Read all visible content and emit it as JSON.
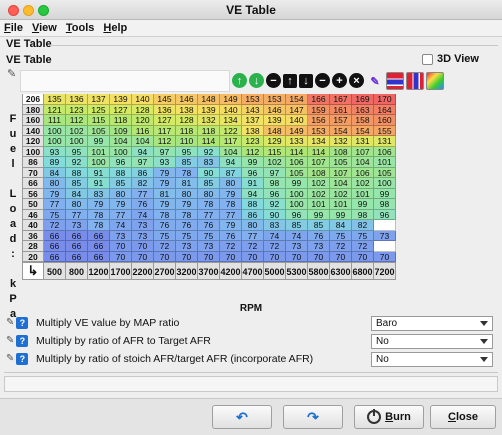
{
  "window": {
    "title": "VE Table"
  },
  "menu": [
    "File",
    "View",
    "Tools",
    "Help"
  ],
  "panel_title": "VE Table",
  "table_title": "VE Table",
  "view3d_label": "3D View",
  "y_axis_label": [
    "F",
    "u",
    "e",
    "l",
    "",
    "L",
    "o",
    "a",
    "d",
    ":",
    "",
    "k",
    "P",
    "a"
  ],
  "y_bins": [
    206,
    180,
    160,
    140,
    120,
    100,
    86,
    70,
    66,
    56,
    50,
    46,
    40,
    36,
    28,
    20
  ],
  "x_bins": [
    500,
    800,
    1200,
    1700,
    2200,
    2700,
    3200,
    3700,
    4200,
    4700,
    5000,
    5300,
    5800,
    6300,
    6800,
    7200
  ],
  "x_axis_label": "RPM",
  "table": [
    [
      135,
      136,
      137,
      139,
      140,
      145,
      146,
      148,
      149,
      153,
      153,
      154,
      166,
      167,
      169,
      170
    ],
    [
      121,
      123,
      125,
      127,
      128,
      136,
      138,
      139,
      140,
      143,
      146,
      147,
      159,
      161,
      163,
      164
    ],
    [
      111,
      112,
      115,
      118,
      120,
      127,
      128,
      132,
      134,
      137,
      139,
      140,
      156,
      157,
      158,
      160
    ],
    [
      100,
      102,
      105,
      109,
      116,
      117,
      118,
      118,
      122,
      138,
      148,
      149,
      153,
      154,
      154,
      155
    ],
    [
      100,
      100,
      99,
      104,
      104,
      112,
      110,
      114,
      117,
      123,
      129,
      133,
      134,
      132,
      131,
      131
    ],
    [
      93,
      95,
      101,
      100,
      94,
      97,
      95,
      92,
      104,
      112,
      115,
      114,
      114,
      108,
      107,
      106
    ],
    [
      89,
      92,
      100,
      96,
      97,
      93,
      85,
      83,
      94,
      99,
      102,
      106,
      107,
      105,
      104,
      101
    ],
    [
      84,
      88,
      91,
      88,
      86,
      79,
      78,
      90,
      87,
      96,
      97,
      105,
      108,
      107,
      106,
      105
    ],
    [
      80,
      85,
      91,
      85,
      82,
      79,
      81,
      85,
      80,
      91,
      98,
      99,
      102,
      104,
      102,
      100
    ],
    [
      79,
      84,
      83,
      80,
      77,
      81,
      80,
      80,
      79,
      94,
      96,
      100,
      102,
      102,
      101,
      99
    ],
    [
      77,
      80,
      79,
      79,
      76,
      79,
      79,
      78,
      78,
      88,
      92,
      100,
      101,
      101,
      99,
      98
    ],
    [
      75,
      77,
      78,
      77,
      74,
      78,
      78,
      77,
      77,
      86,
      90,
      96,
      99,
      99,
      98,
      96
    ],
    [
      72,
      73,
      78,
      74,
      73,
      76,
      76,
      76,
      79,
      80,
      83,
      85,
      85,
      84,
      82,
      null
    ],
    [
      66,
      66,
      66,
      73,
      73,
      75,
      75,
      75,
      76,
      77,
      74,
      74,
      76,
      75,
      75,
      73
    ],
    [
      66,
      66,
      66,
      70,
      70,
      72,
      73,
      73,
      72,
      72,
      72,
      73,
      73,
      72,
      72,
      null
    ],
    [
      66,
      66,
      66,
      70,
      70,
      70,
      70,
      70,
      70,
      70,
      70,
      70,
      70,
      70,
      70,
      70
    ]
  ],
  "options": [
    {
      "label": "Multiply VE value by MAP ratio",
      "value": "Baro"
    },
    {
      "label": "Multiply by ratio of AFR to Target AFR",
      "value": "No"
    },
    {
      "label": "Multiply by ratio of stoich AFR/target AFR (incorporate AFR)",
      "value": "No"
    }
  ],
  "buttons": {
    "burn": "Burn",
    "close": "Close"
  },
  "toolbar_icons": [
    "up-arrow-green-icon",
    "down-arrow-green-icon",
    "minus-icon",
    "up-arrow-icon",
    "down-arrow-icon",
    "decrease-icon",
    "increase-icon",
    "clear-icon",
    "pencil-icon",
    "horizontal-bars-icon",
    "vertical-bars-icon",
    "gradient-icon"
  ]
}
